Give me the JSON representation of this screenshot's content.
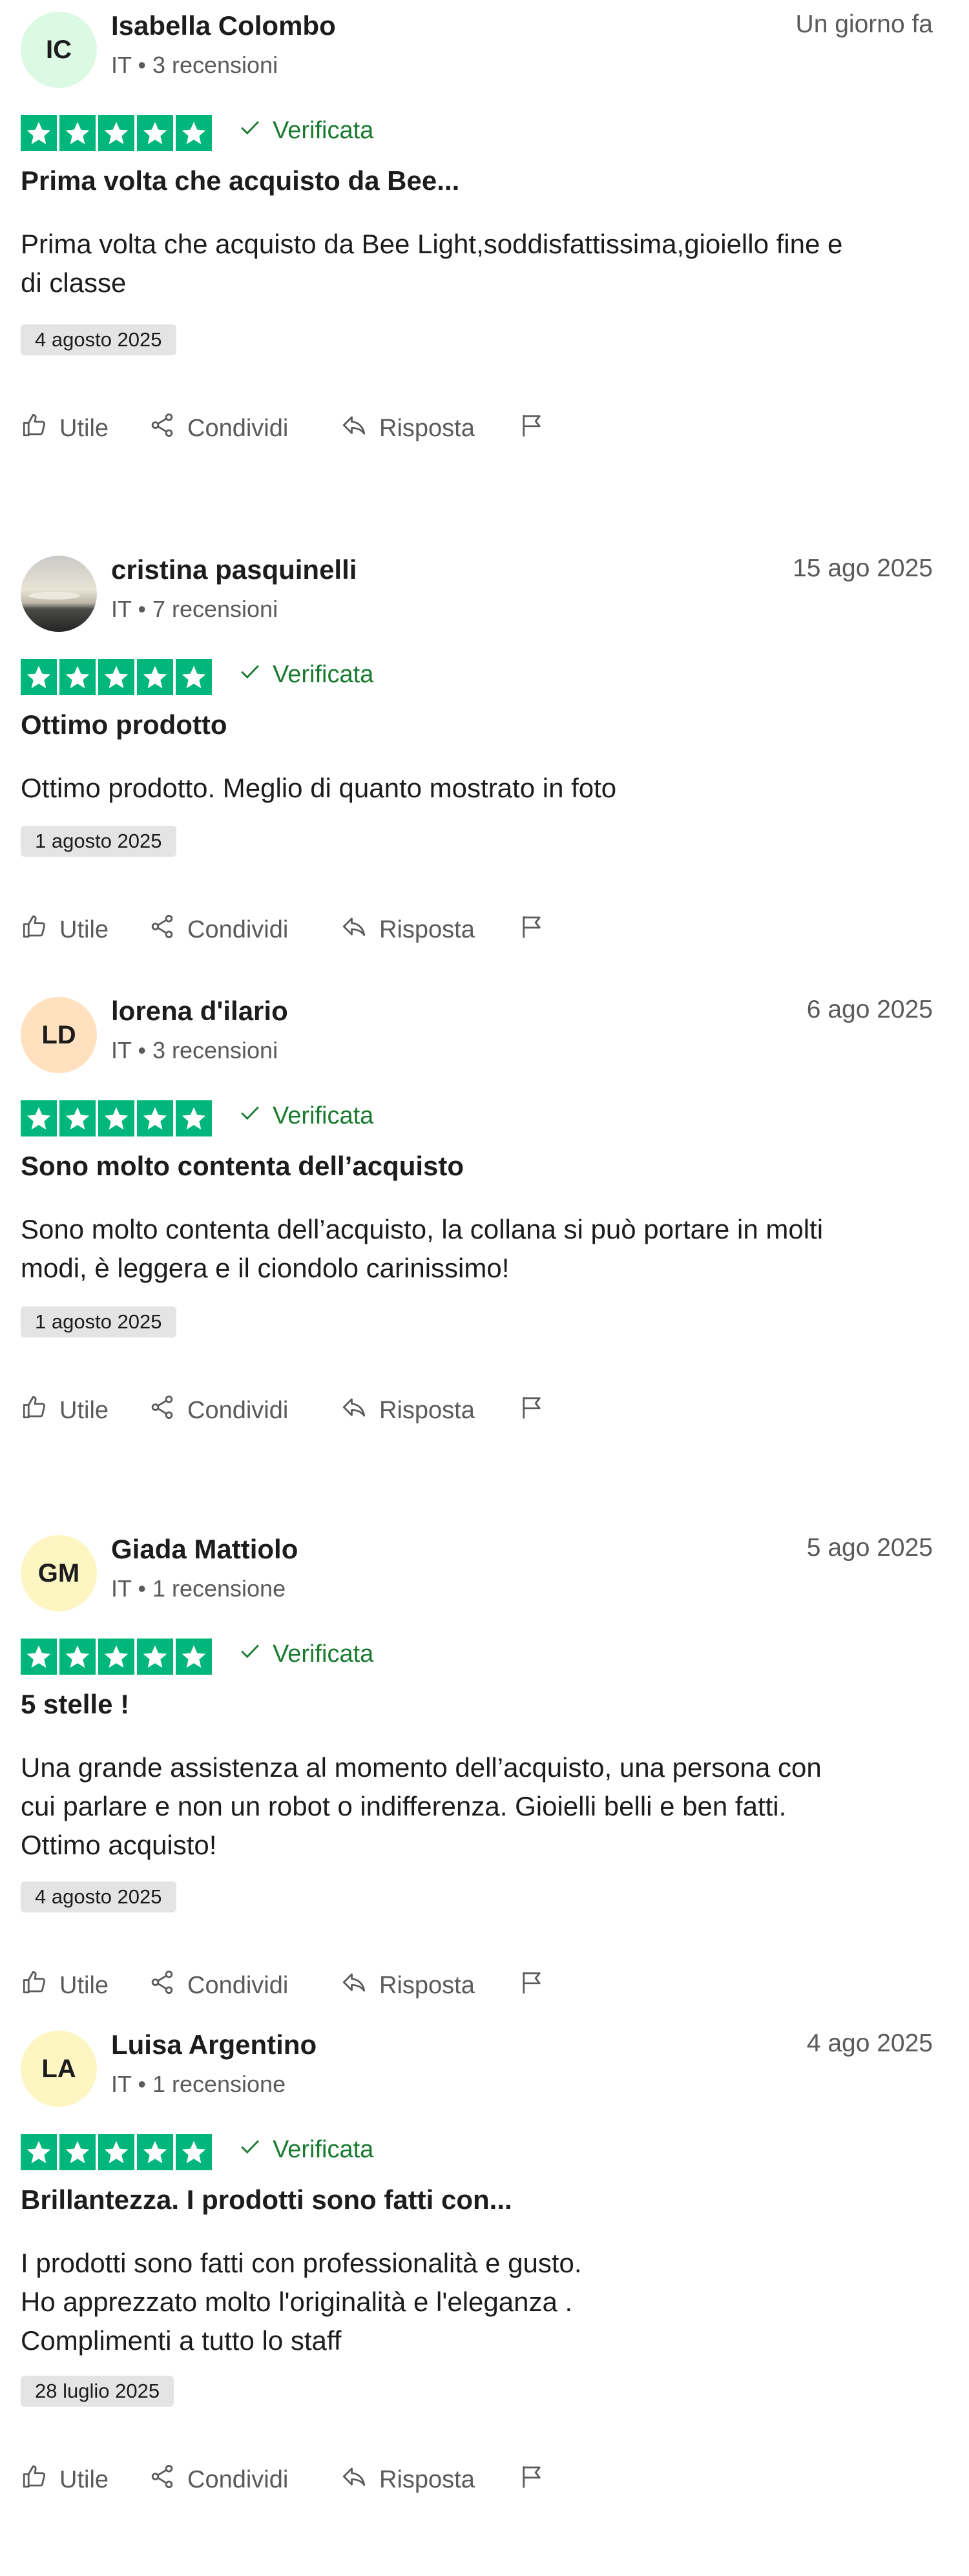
{
  "actions": {
    "useful": "Utile",
    "share": "Condividi",
    "reply": "Risposta"
  },
  "verified_label": "Verificata",
  "rating_color": "#00b67a",
  "verified_color": "#197a2f",
  "reviews": [
    {
      "initials": "IC",
      "avatar_color": "#dcf9e4",
      "name": "Isabella Colombo",
      "meta": "IT • 3 recensioni",
      "date": "Un giorno fa",
      "rating": 5,
      "title": "Prima volta che acquisto da Bee...",
      "body": [
        "Prima volta che acquisto da Bee Light,soddisfattissima,gioiello fine e",
        "di classe"
      ],
      "experience_date": "4 agosto 2025"
    },
    {
      "initials": "",
      "avatar_color": "photo",
      "name": "cristina pasquinelli",
      "meta": "IT • 7 recensioni",
      "date": "15 ago 2025",
      "rating": 5,
      "title": "Ottimo prodotto",
      "body": [
        "Ottimo prodotto. Meglio di quanto mostrato in foto"
      ],
      "experience_date": "1 agosto 2025"
    },
    {
      "initials": "LD",
      "avatar_color": "#ffe1bf",
      "name": "lorena d'ilario",
      "meta": "IT • 3 recensioni",
      "date": "6 ago 2025",
      "rating": 5,
      "title": "Sono molto contenta dell’acquisto",
      "body": [
        "Sono molto contenta dell’acquisto, la collana si può portare in molti",
        "modi, è leggera e il ciondolo carinissimo!"
      ],
      "experience_date": "1 agosto 2025"
    },
    {
      "initials": "GM",
      "avatar_color": "#fdf6c3",
      "name": "Giada Mattiolo",
      "meta": "IT • 1 recensione",
      "date": "5 ago 2025",
      "rating": 5,
      "title": "5 stelle !",
      "body": [
        "Una grande assistenza al momento dell’acquisto, una persona con",
        "cui parlare e non un robot o indifferenza. Gioielli belli e ben fatti.",
        "Ottimo acquisto!"
      ],
      "experience_date": "4 agosto 2025"
    },
    {
      "initials": "LA",
      "avatar_color": "#fdf6c3",
      "name": "Luisa Argentino",
      "meta": "IT • 1 recensione",
      "date": "4 ago 2025",
      "rating": 5,
      "title": "Brillantezza. I prodotti sono fatti con...",
      "body": [
        "I prodotti sono fatti con professionalità e gusto.",
        "Ho apprezzato molto l'originalità e l'eleganza .",
        "Complimenti a tutto lo staff"
      ],
      "experience_date": "28 luglio 2025"
    }
  ]
}
